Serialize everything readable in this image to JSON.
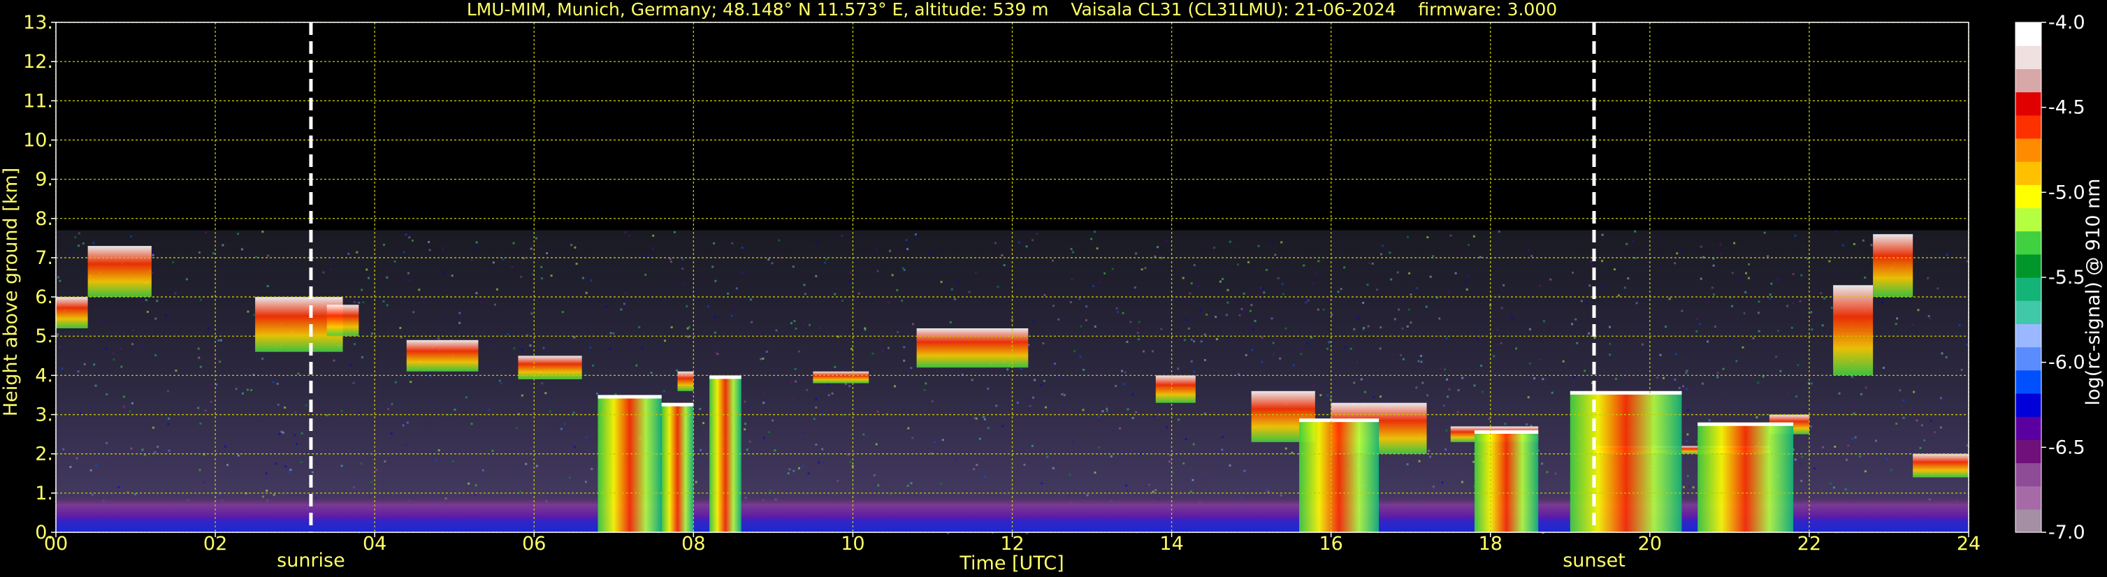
{
  "chart_data": {
    "type": "heatmap",
    "title": "LMU-MIM, Munich, Germany; 48.148° N 11.573° E, altitude: 539 m    Vaisala CL31 (CL31LMU): 21-06-2024    firmware: 3.000",
    "xlabel": "Time [UTC]",
    "ylabel": "Height above ground [km]",
    "xlim": [
      0,
      24
    ],
    "ylim": [
      0,
      13
    ],
    "x_ticks": [
      "00",
      "02",
      "04",
      "06",
      "08",
      "10",
      "12",
      "14",
      "16",
      "18",
      "20",
      "22",
      "24"
    ],
    "x_tick_values": [
      0,
      2,
      4,
      6,
      8,
      10,
      12,
      14,
      16,
      18,
      20,
      22,
      24
    ],
    "y_ticks": [
      "0.",
      "1.",
      "2.",
      "3.",
      "4.",
      "5.",
      "6.",
      "7.",
      "8.",
      "9.",
      "10.",
      "11.",
      "12.",
      "13."
    ],
    "y_tick_values": [
      0,
      1,
      2,
      3,
      4,
      5,
      6,
      7,
      8,
      9,
      10,
      11,
      12,
      13
    ],
    "grid": true,
    "data_top_km": 7.7,
    "markers": [
      {
        "label": "sunrise",
        "time": 3.2
      },
      {
        "label": "sunset",
        "time": 19.3
      }
    ],
    "colorbar": {
      "label": "log(rc-signal) @ 910 nm",
      "range": [
        -7.0,
        -4.0
      ],
      "ticks": [
        "-4.0",
        "-4.5",
        "-5.0",
        "-5.5",
        "-6.0",
        "-6.5",
        "-7.0"
      ],
      "tick_values": [
        -4.0,
        -4.5,
        -5.0,
        -5.5,
        -6.0,
        -6.5,
        -7.0
      ],
      "colors": [
        "#a48fa4",
        "#a66aa6",
        "#8e4b96",
        "#70107a",
        "#5a00a0",
        "#0000d8",
        "#0050ff",
        "#5a8cff",
        "#9ab8ff",
        "#40c8a8",
        "#14b478",
        "#00962a",
        "#40d040",
        "#b4ff40",
        "#ffff00",
        "#ffc000",
        "#ff8c00",
        "#ff3000",
        "#e00000",
        "#d8a8a8",
        "#f0e0e0",
        "#ffffff"
      ]
    },
    "cloud_layers": [
      {
        "start": 0.0,
        "end": 0.4,
        "base": 5.2,
        "top": 6.0
      },
      {
        "start": 0.4,
        "end": 1.2,
        "base": 6.0,
        "top": 7.3
      },
      {
        "start": 2.5,
        "end": 3.6,
        "base": 4.6,
        "top": 6.0
      },
      {
        "start": 3.4,
        "end": 3.8,
        "base": 5.0,
        "top": 5.8
      },
      {
        "start": 4.4,
        "end": 5.3,
        "base": 4.1,
        "top": 4.9
      },
      {
        "start": 5.8,
        "end": 6.6,
        "base": 3.9,
        "top": 4.5
      },
      {
        "start": 7.8,
        "end": 8.0,
        "base": 3.6,
        "top": 4.1
      },
      {
        "start": 9.5,
        "end": 10.2,
        "base": 3.8,
        "top": 4.1
      },
      {
        "start": 10.8,
        "end": 12.2,
        "base": 4.2,
        "top": 5.2
      },
      {
        "start": 13.8,
        "end": 14.3,
        "base": 3.3,
        "top": 4.0
      },
      {
        "start": 15.0,
        "end": 15.8,
        "base": 2.3,
        "top": 3.6
      },
      {
        "start": 16.0,
        "end": 17.2,
        "base": 2.0,
        "top": 3.3
      },
      {
        "start": 17.5,
        "end": 18.6,
        "base": 2.3,
        "top": 2.7
      },
      {
        "start": 19.3,
        "end": 21.5,
        "base": 2.0,
        "top": 2.2
      },
      {
        "start": 21.5,
        "end": 22.0,
        "base": 2.5,
        "top": 3.0
      },
      {
        "start": 22.3,
        "end": 22.8,
        "base": 4.0,
        "top": 6.3
      },
      {
        "start": 22.8,
        "end": 23.3,
        "base": 6.0,
        "top": 7.6
      },
      {
        "start": 23.3,
        "end": 24.0,
        "base": 1.4,
        "top": 2.0
      }
    ],
    "convective_cells": [
      {
        "start": 6.8,
        "end": 7.6,
        "top": 3.5
      },
      {
        "start": 7.6,
        "end": 8.0,
        "top": 3.3
      },
      {
        "start": 8.2,
        "end": 8.6,
        "top": 4.0
      },
      {
        "start": 15.6,
        "end": 16.6,
        "top": 2.9
      },
      {
        "start": 17.8,
        "end": 18.6,
        "top": 2.6
      },
      {
        "start": 19.0,
        "end": 20.4,
        "top": 3.6
      },
      {
        "start": 20.6,
        "end": 21.8,
        "top": 2.8
      }
    ]
  }
}
